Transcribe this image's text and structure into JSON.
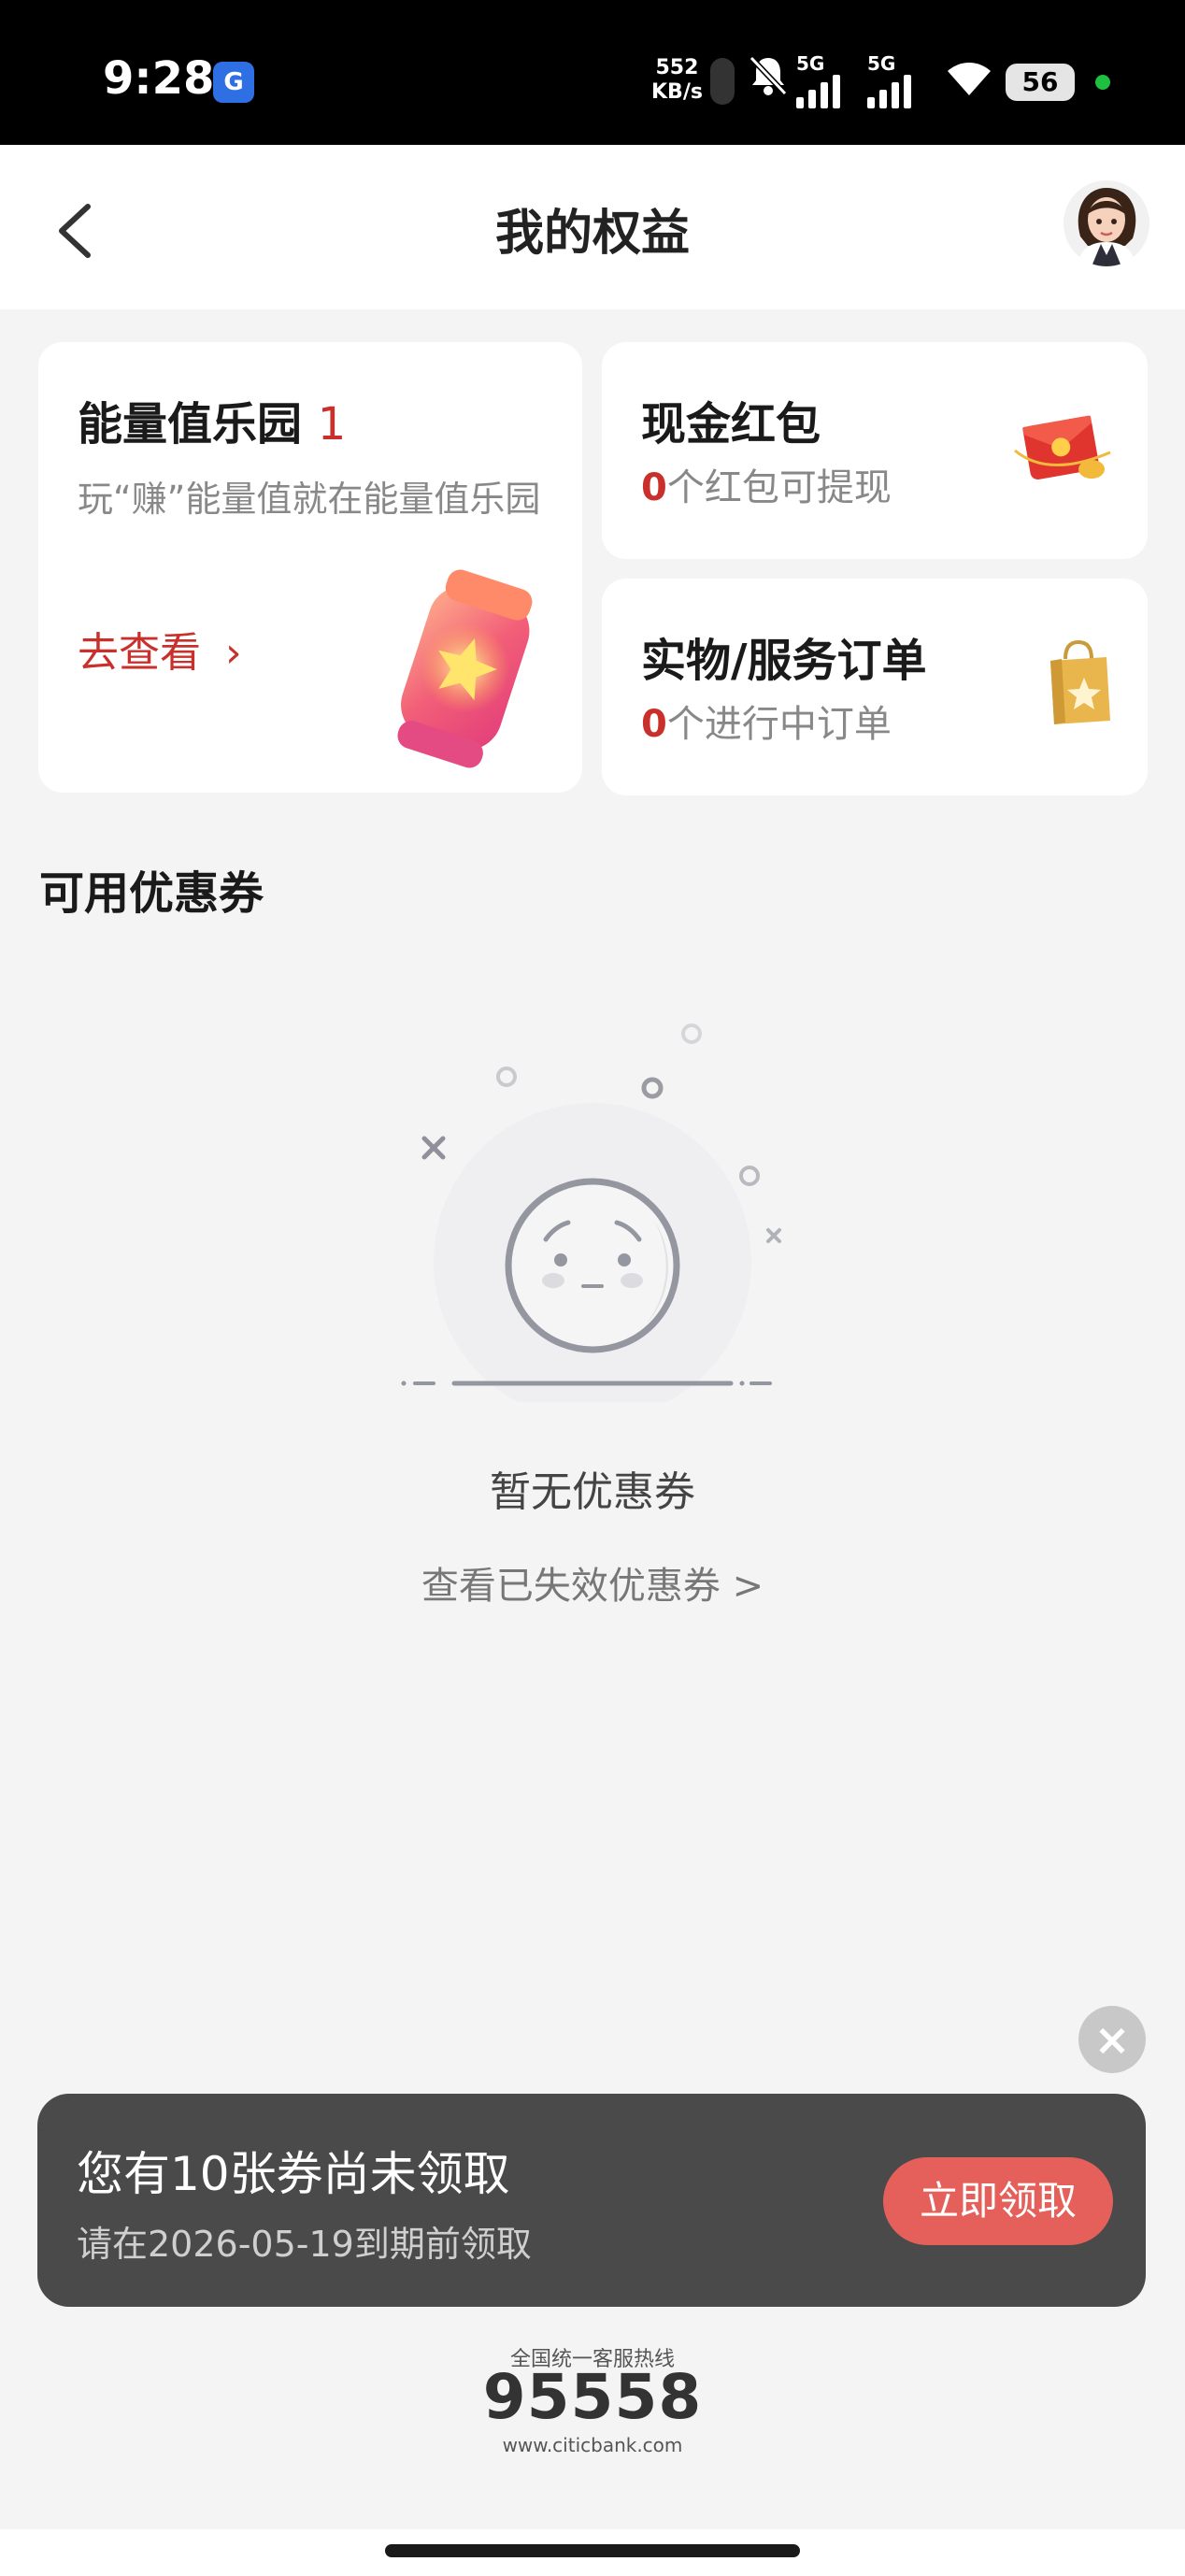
{
  "status_bar": {
    "time": "9:28",
    "app_badge": "G",
    "net_speed_value": "552",
    "net_speed_unit": "KB/s",
    "signal_1": "5G",
    "signal_2": "5G",
    "battery": "56"
  },
  "header": {
    "title": "我的权益",
    "back_icon": "chevron-left-icon",
    "avatar_icon": "avatar-icon"
  },
  "energy_card": {
    "title": "能量值乐园",
    "count": "1",
    "desc": "玩“赚”能量值就在能量值乐园",
    "link": "去查看",
    "link_arrow": "›"
  },
  "cash_card": {
    "title": "现金红包",
    "count": "0",
    "desc": "个红包可提现"
  },
  "order_card": {
    "title": "实物/服务订单",
    "count": "0",
    "desc": "个进行中订单"
  },
  "coupons": {
    "section_title": "可用优惠券",
    "empty_text": "暂无优惠券",
    "expired_link": "查看已失效优惠券 >"
  },
  "banner": {
    "title": "您有10张券尚未领取",
    "subtitle": "请在2026-05-19到期前领取",
    "button": "立即领取",
    "close": "×"
  },
  "footer": {
    "hotline_label": "全国统一客服热线",
    "hotline_number": "95558",
    "website": "www.citicbank.com"
  },
  "colors": {
    "accent": "#c9302c",
    "button": "#e5605a",
    "banner_bg": "#4a4a4a",
    "page_bg": "#f4f4f5"
  }
}
